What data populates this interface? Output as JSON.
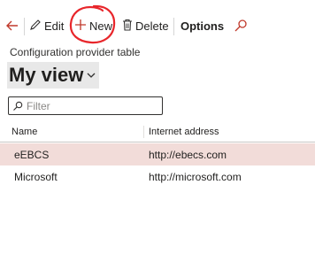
{
  "toolbar": {
    "edit_label": "Edit",
    "new_label": "New",
    "delete_label": "Delete",
    "options_label": "Options"
  },
  "header": {
    "caption": "Configuration provider table",
    "view_name": "My view"
  },
  "filter": {
    "placeholder": "Filter",
    "value": ""
  },
  "grid": {
    "columns": [
      "Name",
      "Internet address"
    ],
    "rows": [
      {
        "name": "eEBCS",
        "address": "http://ebecs.com",
        "selected": true
      },
      {
        "name": "Microsoft",
        "address": "http://microsoft.com",
        "selected": false
      }
    ]
  },
  "colors": {
    "annotation_circle": "#e8262b",
    "selected_row": "#f2dcd9",
    "back_arrow": "#c0392b",
    "search_icon": "#c0392b"
  }
}
